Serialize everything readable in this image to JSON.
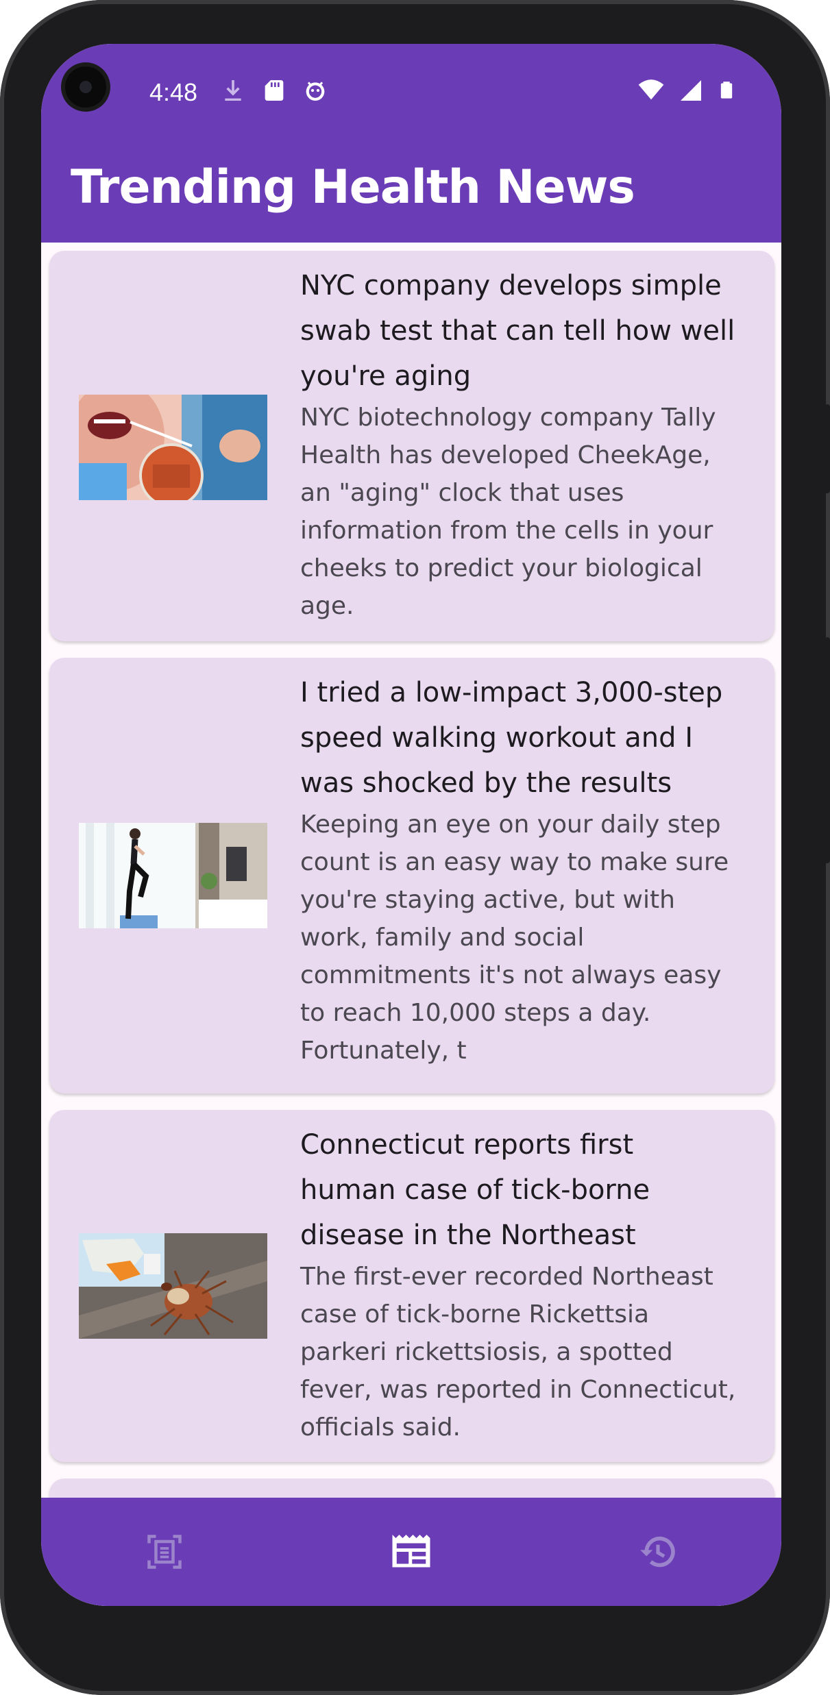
{
  "status_bar": {
    "time": "4:48",
    "left_icons": [
      "download-icon",
      "sd-card-icon",
      "android-debug-icon"
    ],
    "right_icons": [
      "wifi-icon",
      "cell-signal-icon",
      "battery-icon"
    ]
  },
  "app_bar": {
    "title": "Trending Health News"
  },
  "articles": [
    {
      "title": "NYC company develops simple swab test that can tell how well you're aging",
      "summary": "NYC biotechnology company Tally Health has developed CheekAge, an \"aging\" clock that uses information from the cells in your cheeks to predict your biological age.",
      "image": "cheek-swab-test-photo"
    },
    {
      "title": "I tried a low-impact 3,000-step speed walking workout and I was shocked by the results",
      "summary": "Keeping an eye on your daily step count is an easy way to make sure you're staying active, but with work, family and social commitments it's not always easy to reach 10,000 steps a day. Fortunately, t",
      "image": "woman-walking-workout-photo"
    },
    {
      "title": "Connecticut reports first human case of tick-borne disease in the Northeast",
      "summary": "The first-ever recorded Northeast case of tick-borne Rickettsia parkeri rickettsiosis, a spotted fever, was reported in Connecticut, officials said.",
      "image": "tick-and-map-photo"
    }
  ],
  "bottom_nav": {
    "items": [
      {
        "icon": "document-scan-icon",
        "active": false
      },
      {
        "icon": "newspaper-icon",
        "active": true
      },
      {
        "icon": "history-icon",
        "active": false
      }
    ]
  },
  "colors": {
    "primary": "#6a3cb6",
    "card_background": "#e9daef",
    "screen_background": "#fff9fe",
    "nav_inactive_icon": "#9b84cc",
    "nav_active_icon": "#ffffff"
  }
}
